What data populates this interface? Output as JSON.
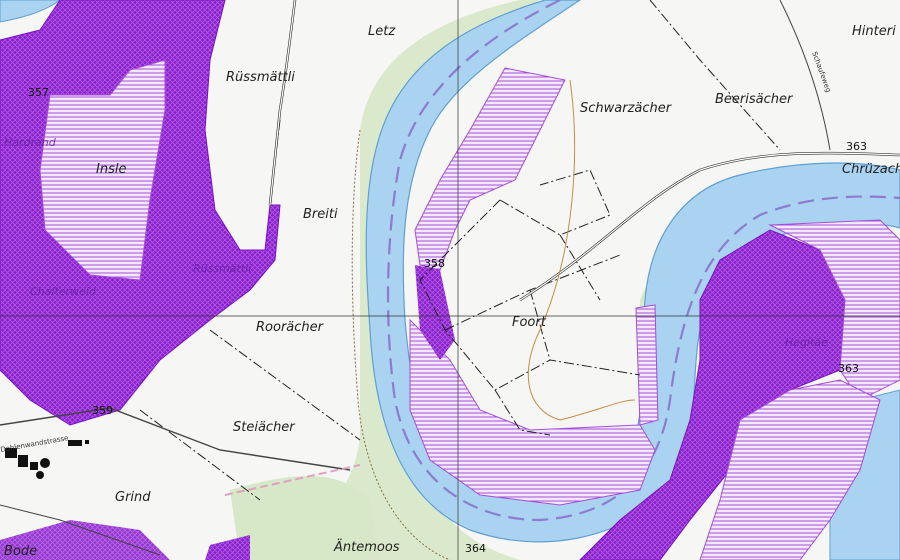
{
  "colors": {
    "river": "#a9d3f0",
    "river_edge": "#5f9fd2",
    "meadow": "#d7e8c8",
    "protected_fill": "#8a1fd0",
    "hatch": "#a44fd8",
    "background": "#f6f6f4"
  },
  "labels": {
    "letz": "Letz",
    "russmattli": "Rüssmättli",
    "hinteri": "Hinteri B",
    "schwarzacher": "Schwarzächer",
    "beerisacher": "Beerisächer",
    "insle": "Insle",
    "breiti": "Breiti",
    "chruzacher": "Chrüzacher",
    "rooracher": "Roorächer",
    "foort": "Foort",
    "steiacher": "Steiächer",
    "grind": "Grind",
    "bode": "Bode",
    "antemoos": "Äntemoos",
    "hardrand": "Hardrand",
    "chalterweid": "Chalterweid",
    "russmatteli": "Rüssmättli",
    "hegitäe": "Hegitäe",
    "schaufeweg": "Schaufeweg",
    "dohlenwandstrasse": "Dohlenwandstrasse"
  },
  "spot_heights": {
    "h357": "357",
    "h358": "358",
    "h363a": "363",
    "h363b": "363",
    "h364": "364",
    "h359": "359"
  }
}
